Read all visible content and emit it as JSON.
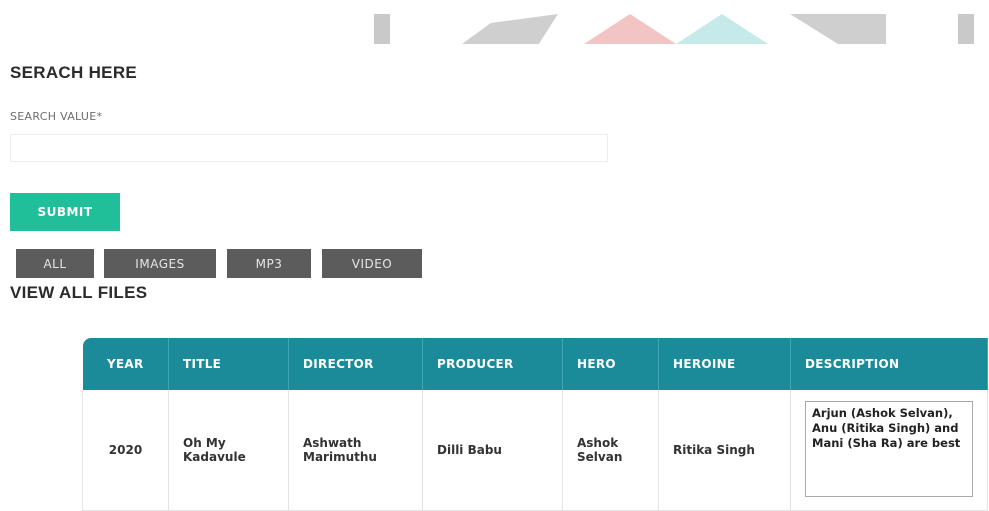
{
  "search": {
    "heading": "SERACH HERE",
    "label": "SEARCH VALUE*",
    "value": "",
    "placeholder": "",
    "submit_label": "SUBMIT"
  },
  "filters": {
    "all": "ALL",
    "images": "IMAGES",
    "mp3": "MP3",
    "video": "VIDEO"
  },
  "files": {
    "heading": "VIEW ALL FILES",
    "columns": {
      "year": "YEAR",
      "title": "TITLE",
      "director": "DIRECTOR",
      "producer": "PRODUCER",
      "hero": "HERO",
      "heroine": "HEROINE",
      "description": "DESCRIPTION"
    },
    "rows": [
      {
        "year": "2020",
        "title": "Oh My Kadavule",
        "director": "Ashwath Marimuthu",
        "producer": "Dilli Babu",
        "hero": "Ashok Selvan",
        "heroine": "Ritika Singh",
        "description": "Arjun (Ashok Selvan), Anu (Ritika Singh) and Mani (Sha Ra) are best"
      }
    ]
  },
  "colors": {
    "submit": "#21bf99",
    "filter": "#5c5c5c",
    "table_header": "#1b8a99"
  }
}
